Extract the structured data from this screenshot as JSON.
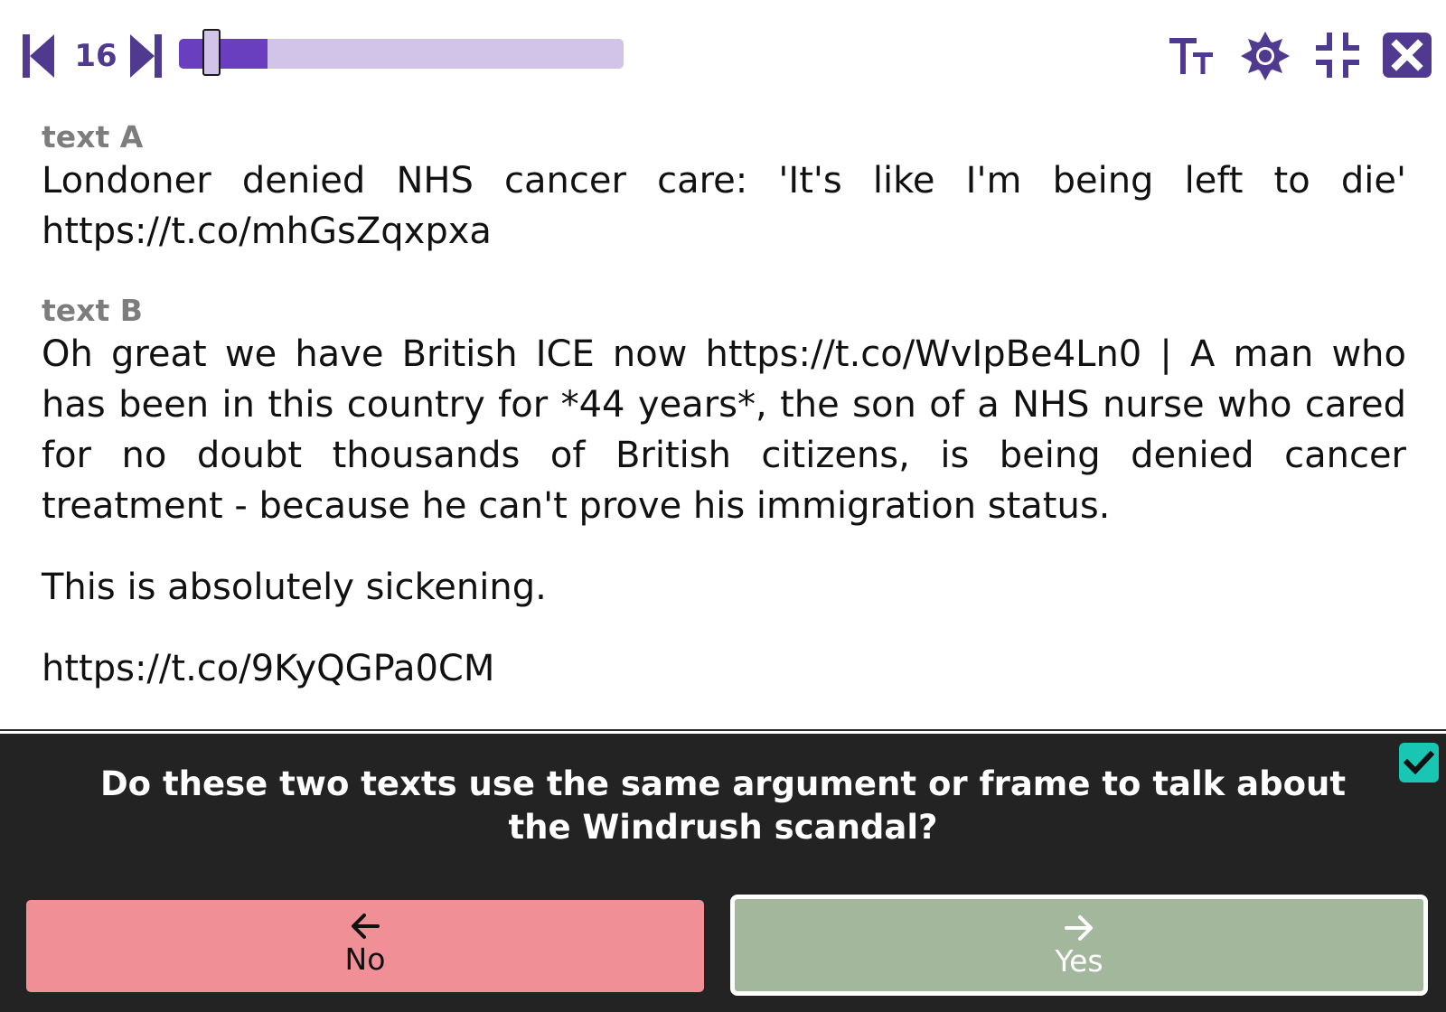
{
  "toolbar": {
    "item_number": "16",
    "progress_fraction": 0.2,
    "accent_color": "#6a3fbf",
    "icons": [
      "skip-previous-icon",
      "skip-next-icon",
      "font-size-icon",
      "brightness-icon",
      "collapse-icon",
      "close-icon"
    ]
  },
  "text_a": {
    "label": "text A",
    "body": "Londoner denied NHS cancer care: 'It's like I'm being left to die' https://t.co/mhGsZqxpxa"
  },
  "text_b": {
    "label": "text B",
    "paragraphs": [
      "Oh great we have British ICE now https://t.co/WvIpBe4Ln0 | A man who has been in this country for *44 years*, the son of a NHS nurse who cared for no doubt thousands of British citizens, is being denied cancer treatment - because he can't prove his immigration status.",
      "This is absolutely sickening.",
      "https://t.co/9KyQGPa0CM"
    ]
  },
  "question": {
    "text": "Do these two texts use the same argument or frame to talk about the Windrush scandal?",
    "checked": true
  },
  "answers": {
    "no_label": "No",
    "yes_label": "Yes",
    "no_color": "#f08f96",
    "yes_color": "#a3b79d"
  }
}
